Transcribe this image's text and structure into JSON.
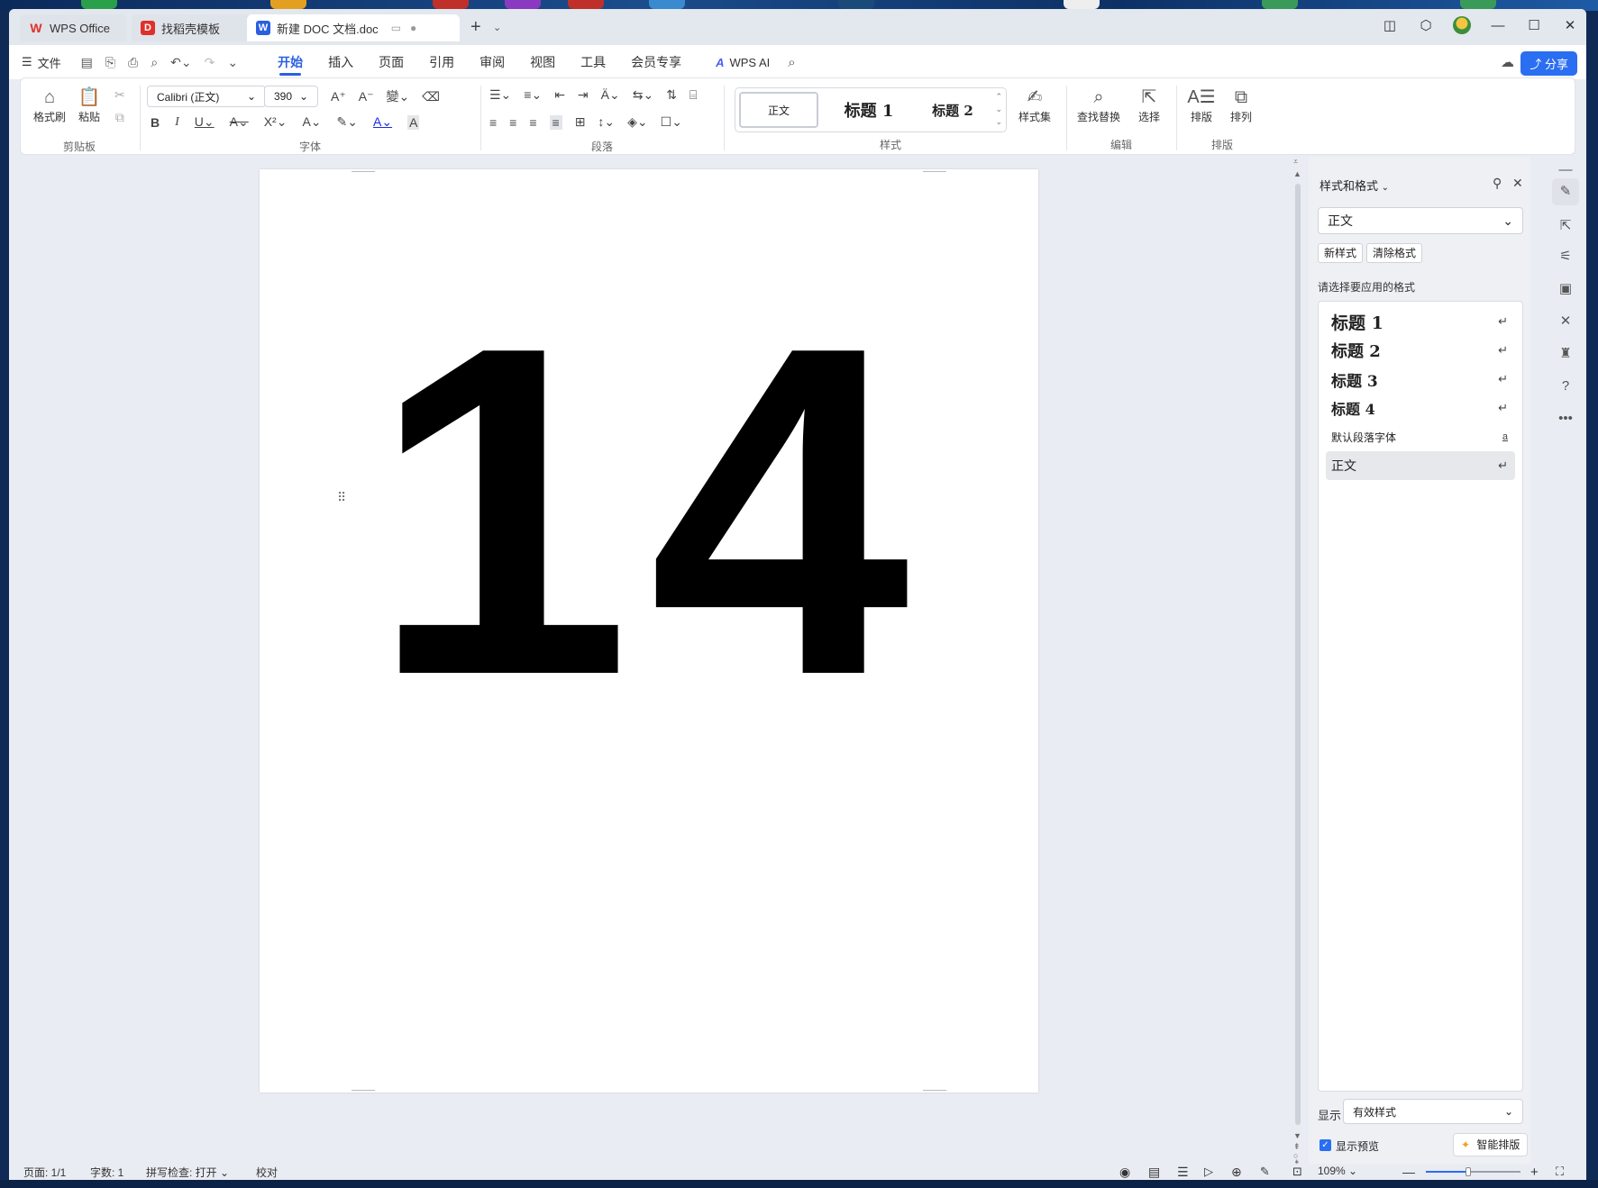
{
  "tabs": [
    {
      "label": "WPS Office",
      "logo": "W",
      "color": "#e0302a"
    },
    {
      "label": "找稻壳模板",
      "logo": "D",
      "color": "#e0302a"
    },
    {
      "label": "新建 DOC 文档.doc",
      "logo": "W",
      "color": "#2a5fe0"
    }
  ],
  "menu": {
    "file": "文件",
    "tabs": [
      "开始",
      "插入",
      "页面",
      "引用",
      "审阅",
      "视图",
      "工具",
      "会员专享"
    ],
    "active_tab": "开始",
    "wps_ai": "WPS AI",
    "share": "分享"
  },
  "ribbon": {
    "clipboard": {
      "format_painter": "格式刷",
      "paste": "粘贴",
      "label": "剪贴板"
    },
    "font": {
      "name": "Calibri (正文)",
      "size": "390",
      "label": "字体"
    },
    "paragraph": {
      "label": "段落"
    },
    "styles": {
      "items": [
        "正文",
        "标题 1",
        "标题 2"
      ],
      "style_set": "样式集",
      "label": "样式"
    },
    "edit": {
      "find_replace": "查找替换",
      "select": "选择",
      "label": "编辑"
    },
    "layout": {
      "typeset": "排版",
      "arrange": "排列",
      "label": "排版"
    }
  },
  "document": {
    "content": "14"
  },
  "styles_pane": {
    "title": "样式和格式",
    "current_style": "正文",
    "new_style": "新样式",
    "clear_format": "清除格式",
    "hint": "请选择要应用的格式",
    "items": [
      {
        "label": "标题 1",
        "marker": "↵"
      },
      {
        "label": "标题 2",
        "marker": "↵"
      },
      {
        "label": "标题 3",
        "marker": "↵"
      },
      {
        "label": "标题 4",
        "marker": "↵"
      },
      {
        "label": "默认段落字体",
        "marker": "a"
      },
      {
        "label": "正文",
        "marker": "↵"
      }
    ],
    "selected": "正文",
    "show_label": "显示",
    "show_value": "有效样式",
    "preview_label": "显示预览",
    "preview_checked": true,
    "smart_layout": "智能排版"
  },
  "statusbar": {
    "page": "页面: 1/1",
    "words": "字数: 1",
    "spell": "拼写检查: 打开",
    "proof": "校对",
    "zoom": "109%",
    "zoom_level": 0.45
  },
  "colors": {
    "accent": "#2a5fe0",
    "share_button": "#2a6ef2"
  }
}
